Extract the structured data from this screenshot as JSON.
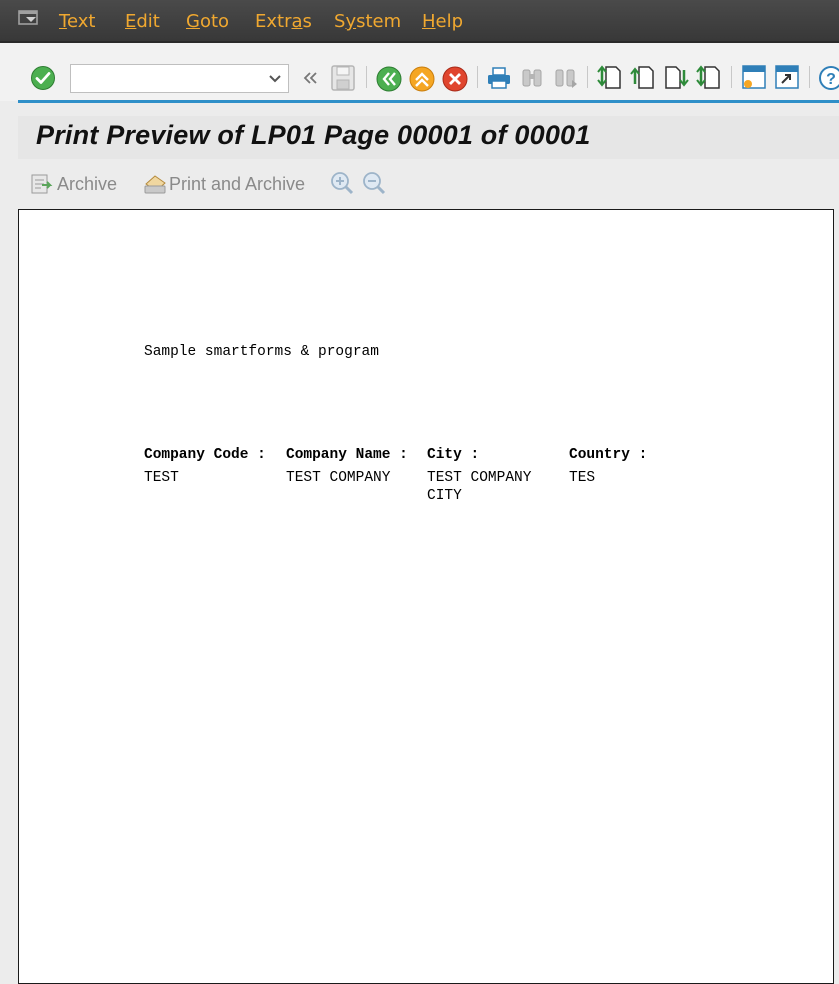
{
  "menu": {
    "items": [
      {
        "label": "Text",
        "accel": "T"
      },
      {
        "label": "Edit",
        "accel": "E"
      },
      {
        "label": "Goto",
        "accel": "G"
      },
      {
        "label": "Extras",
        "accel": "a"
      },
      {
        "label": "System",
        "accel": "y"
      },
      {
        "label": "Help",
        "accel": "H"
      }
    ]
  },
  "toolbar": {
    "command_value": "",
    "icons": [
      "enter-icon",
      "back-double-icon",
      "save-icon",
      "back-icon",
      "exit-icon",
      "cancel-icon",
      "print-icon",
      "find-icon",
      "find-next-icon",
      "first-page-icon",
      "previous-page-icon",
      "next-page-icon",
      "last-page-icon",
      "create-session-icon",
      "shortcut-icon",
      "help-icon"
    ]
  },
  "title": "Print Preview of LP01 Page 00001 of 00001",
  "app_toolbar": {
    "archive_label": "Archive",
    "print_archive_label": "Print and Archive"
  },
  "document": {
    "heading": "Sample smartforms & program",
    "columns": [
      {
        "header": "Company Code :",
        "values": [
          "TEST"
        ]
      },
      {
        "header": "Company Name :",
        "values": [
          "TEST COMPANY"
        ]
      },
      {
        "header": "City :",
        "values": [
          "TEST COMPANY",
          "CITY"
        ]
      },
      {
        "header": "Country :",
        "values": [
          "TES"
        ]
      }
    ]
  },
  "colors": {
    "menu_bg": "#3c3c3c",
    "menu_text": "#f0a830",
    "accent_line": "#2f8fc8",
    "enter_green": "#4caf50",
    "exit_orange": "#f5a623",
    "cancel_red": "#e0452e"
  }
}
